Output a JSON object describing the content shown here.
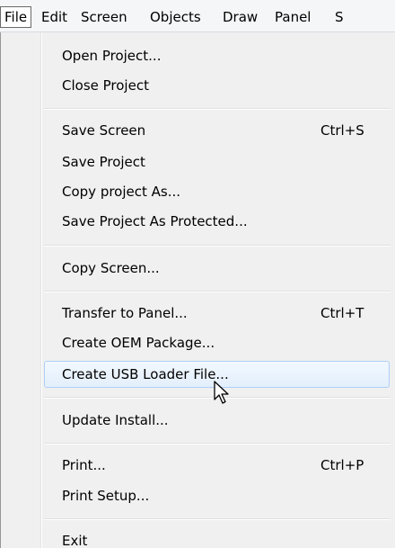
{
  "menubar": {
    "items": [
      {
        "label": "File"
      },
      {
        "label": "Edit"
      },
      {
        "label": "Screen"
      },
      {
        "label": "Objects"
      },
      {
        "label": "Draw"
      },
      {
        "label": "Panel"
      },
      {
        "label": "S"
      }
    ]
  },
  "file_menu": {
    "items": [
      {
        "label": "Open Project...",
        "shortcut": ""
      },
      {
        "label": "Close Project",
        "shortcut": ""
      },
      {
        "label": "Save Screen",
        "shortcut": "Ctrl+S"
      },
      {
        "label": "Save Project",
        "shortcut": ""
      },
      {
        "label": "Copy project As...",
        "shortcut": ""
      },
      {
        "label": "Save Project As Protected...",
        "shortcut": ""
      },
      {
        "label": "Copy Screen...",
        "shortcut": ""
      },
      {
        "label": "Transfer to Panel...",
        "shortcut": "Ctrl+T"
      },
      {
        "label": "Create OEM Package...",
        "shortcut": ""
      },
      {
        "label": "Create USB Loader File...",
        "shortcut": ""
      },
      {
        "label": "Update Install...",
        "shortcut": ""
      },
      {
        "label": "Print...",
        "shortcut": "Ctrl+P"
      },
      {
        "label": "Print Setup...",
        "shortcut": ""
      },
      {
        "label": "Exit",
        "shortcut": ""
      }
    ],
    "highlighted_item": "Create USB Loader File..."
  },
  "cursor": {
    "icon": "arrow-pointer-icon"
  },
  "colors": {
    "highlight_border": "#aecff7",
    "highlight_fill": "#e3effc",
    "menu_background": "#f0f0f0"
  }
}
